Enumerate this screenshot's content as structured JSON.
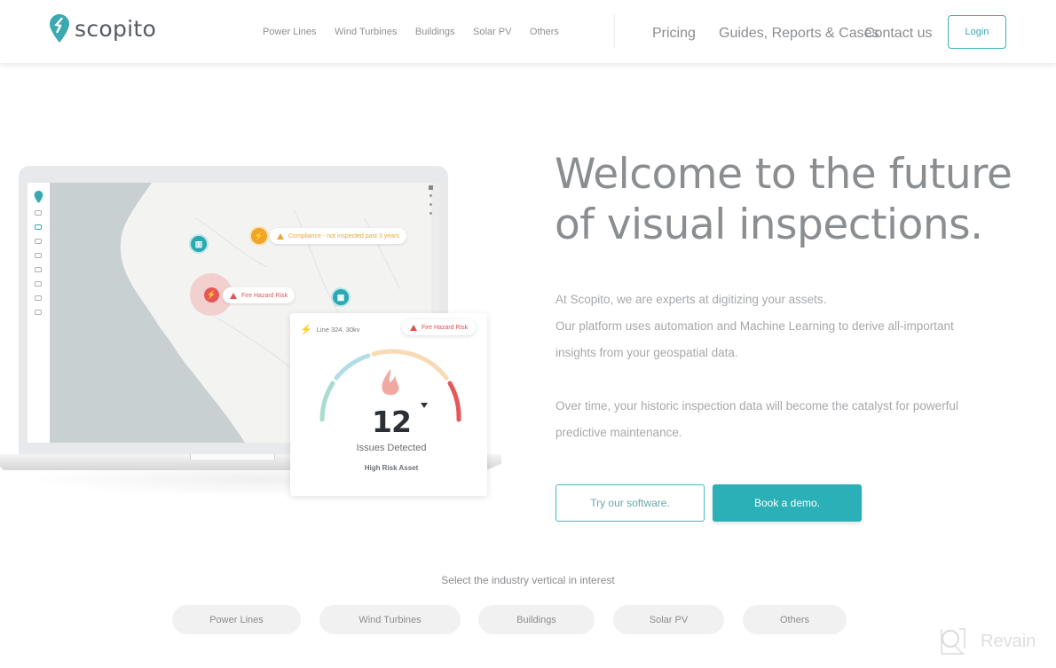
{
  "brand": {
    "name": "scopito",
    "accent": "#2bb0b7"
  },
  "nav": {
    "left": [
      "Power Lines",
      "Wind Turbines",
      "Buildings",
      "Solar PV",
      "Others"
    ],
    "right": [
      "Pricing",
      "Guides, Reports & Cases",
      "Contact us"
    ],
    "login": "Login"
  },
  "mockup": {
    "map_pills": {
      "compliance": "Compliance - not inspected past 3 years",
      "fire": "Fire Hazard Risk"
    },
    "card": {
      "line": "Line 324. 30kv",
      "badge": "Fire Hazard Risk",
      "count": "12",
      "issues_label": "Issues Detected",
      "risk_label": "High Risk Asset"
    }
  },
  "hero": {
    "title_line1": "Welcome to the future",
    "title_line2": "of visual inspections.",
    "p1": "At Scopito, we are experts at digitizing your assets.",
    "p2a": "Our platform uses automation and Machine Learning to derive all-important",
    "p2b": "insights from your geospatial data.",
    "p3a": "Over time, your historic inspection data will become the catalyst for powerful",
    "p3b": "predictive maintenance.",
    "try_button": "Try our software.",
    "demo_button": "Book a demo."
  },
  "verticals": {
    "label": "Select the industry vertical in interest",
    "options": [
      "Power Lines",
      "Wind Turbines",
      "Buildings",
      "Solar PV",
      "Others"
    ]
  },
  "watermark": "Revain"
}
